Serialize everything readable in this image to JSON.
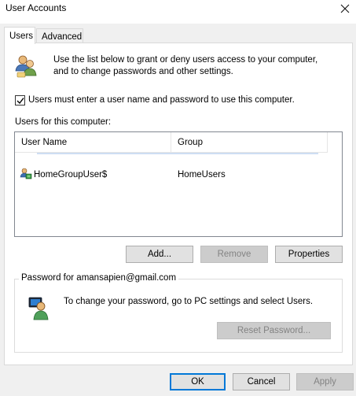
{
  "window": {
    "title": "User Accounts"
  },
  "tabs": [
    {
      "label": "Users",
      "active": true
    },
    {
      "label": "Advanced",
      "active": false
    }
  ],
  "intro": {
    "line1": "Use the list below to grant or deny users access to your computer,",
    "line2": "and to change passwords and other settings."
  },
  "require_login": {
    "label": "Users must enter a user name and password to use this computer.",
    "checked": true
  },
  "users_section": {
    "label": "Users for this computer:",
    "columns": [
      "User Name",
      "Group"
    ],
    "rows": [
      {
        "user_name": "HomeGroupUser$",
        "group": "HomeUsers"
      }
    ]
  },
  "user_buttons": {
    "add": "Add...",
    "remove": "Remove",
    "properties": "Properties"
  },
  "password_group": {
    "legend": "Password for amansapien@gmail.com",
    "message": "To change your password, go to PC settings and select Users.",
    "reset_button": "Reset Password..."
  },
  "dialog_buttons": {
    "ok": "OK",
    "cancel": "Cancel",
    "apply": "Apply"
  },
  "colors": {
    "accent": "#0078d7",
    "panel_border": "#d9d9d9",
    "dialog_bg": "#f0f0f0"
  }
}
